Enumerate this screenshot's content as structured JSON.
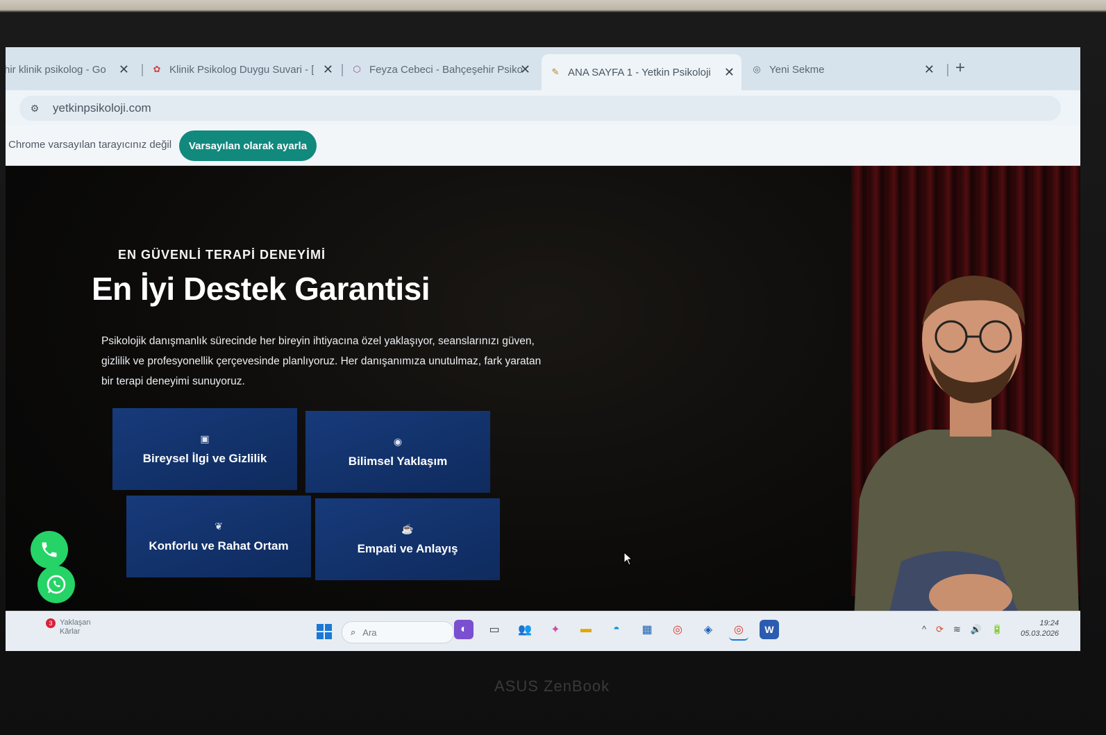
{
  "browser": {
    "tabs": [
      {
        "title": "hir klinik psikolog - Go",
        "icon": "google-icon",
        "active": false
      },
      {
        "title": "Klinik Psikolog Duygu Suvari - [",
        "icon": "site-favicon",
        "active": false
      },
      {
        "title": "Feyza Cebeci - Bahçeşehir Psiko",
        "icon": "site-favicon",
        "active": false
      },
      {
        "title": "ANA SAYFA 1 - Yetkin Psikoloji",
        "icon": "site-favicon",
        "active": true
      },
      {
        "title": "Yeni Sekme",
        "icon": "chrome-icon",
        "active": false
      }
    ],
    "new_tab_label": "+",
    "close_label": "✕",
    "url": "yetkinpsikoloji.com"
  },
  "infobar": {
    "message": "Chrome varsayılan tarayıcınız değil",
    "button_label": "Varsayılan olarak ayarla",
    "button_color": "#11897d"
  },
  "hero": {
    "eyebrow": "EN GÜVENLİ TERAPİ DENEYİMİ",
    "title": "En İyi Destek Garantisi",
    "description": "Psikolojik danışmanlık sürecinde her bireyin ihtiyacına özel yaklaşıyor, seanslarınızı güven, gizlilik ve profesyonellik çerçevesinde planlıyoruz. Her danışanımıza unutulmaz, fark yaratan bir terapi deneyimi sunuyoruz."
  },
  "features": [
    {
      "label": "Bireysel İlgi ve Gizlilik",
      "icon": "id-card-icon",
      "glyph": "▣"
    },
    {
      "label": "Bilimsel Yaklaşım",
      "icon": "eye-icon",
      "glyph": "◉"
    },
    {
      "label": "Konforlu ve Rahat Ortam",
      "icon": "leaf-icon",
      "glyph": "❦"
    },
    {
      "label": "Empati ve Anlayış",
      "icon": "coffee-icon",
      "glyph": "☕"
    }
  ],
  "card_color": "#173a7a",
  "contact": {
    "phone_icon": "phone-icon",
    "whatsapp_icon": "whatsapp-icon",
    "color": "#25d366"
  },
  "taskbar": {
    "weather_badge": "3",
    "weather_line1": "Yaklaşan",
    "weather_line2": "Kârlar",
    "search_placeholder": "Ara",
    "apps": [
      {
        "name": "widgets-icon",
        "glyph": "◐"
      },
      {
        "name": "task-view-icon",
        "glyph": "▭"
      },
      {
        "name": "teams-icon",
        "glyph": "👥"
      },
      {
        "name": "copilot-icon",
        "glyph": "✦"
      },
      {
        "name": "file-explorer-icon",
        "glyph": "▬"
      },
      {
        "name": "edge-icon",
        "glyph": "◓"
      },
      {
        "name": "store-icon",
        "glyph": "▦"
      },
      {
        "name": "chrome-icon",
        "glyph": "◎"
      },
      {
        "name": "defender-icon",
        "glyph": "◈"
      },
      {
        "name": "chrome-alt-icon",
        "glyph": "◎"
      },
      {
        "name": "word-icon",
        "glyph": "W"
      }
    ],
    "tray": [
      "^",
      "⟳",
      "≋",
      "🔊",
      "🔋"
    ],
    "time": "19:24",
    "date": "05.03.2026"
  },
  "device_brand": "ASUS ZenBook"
}
